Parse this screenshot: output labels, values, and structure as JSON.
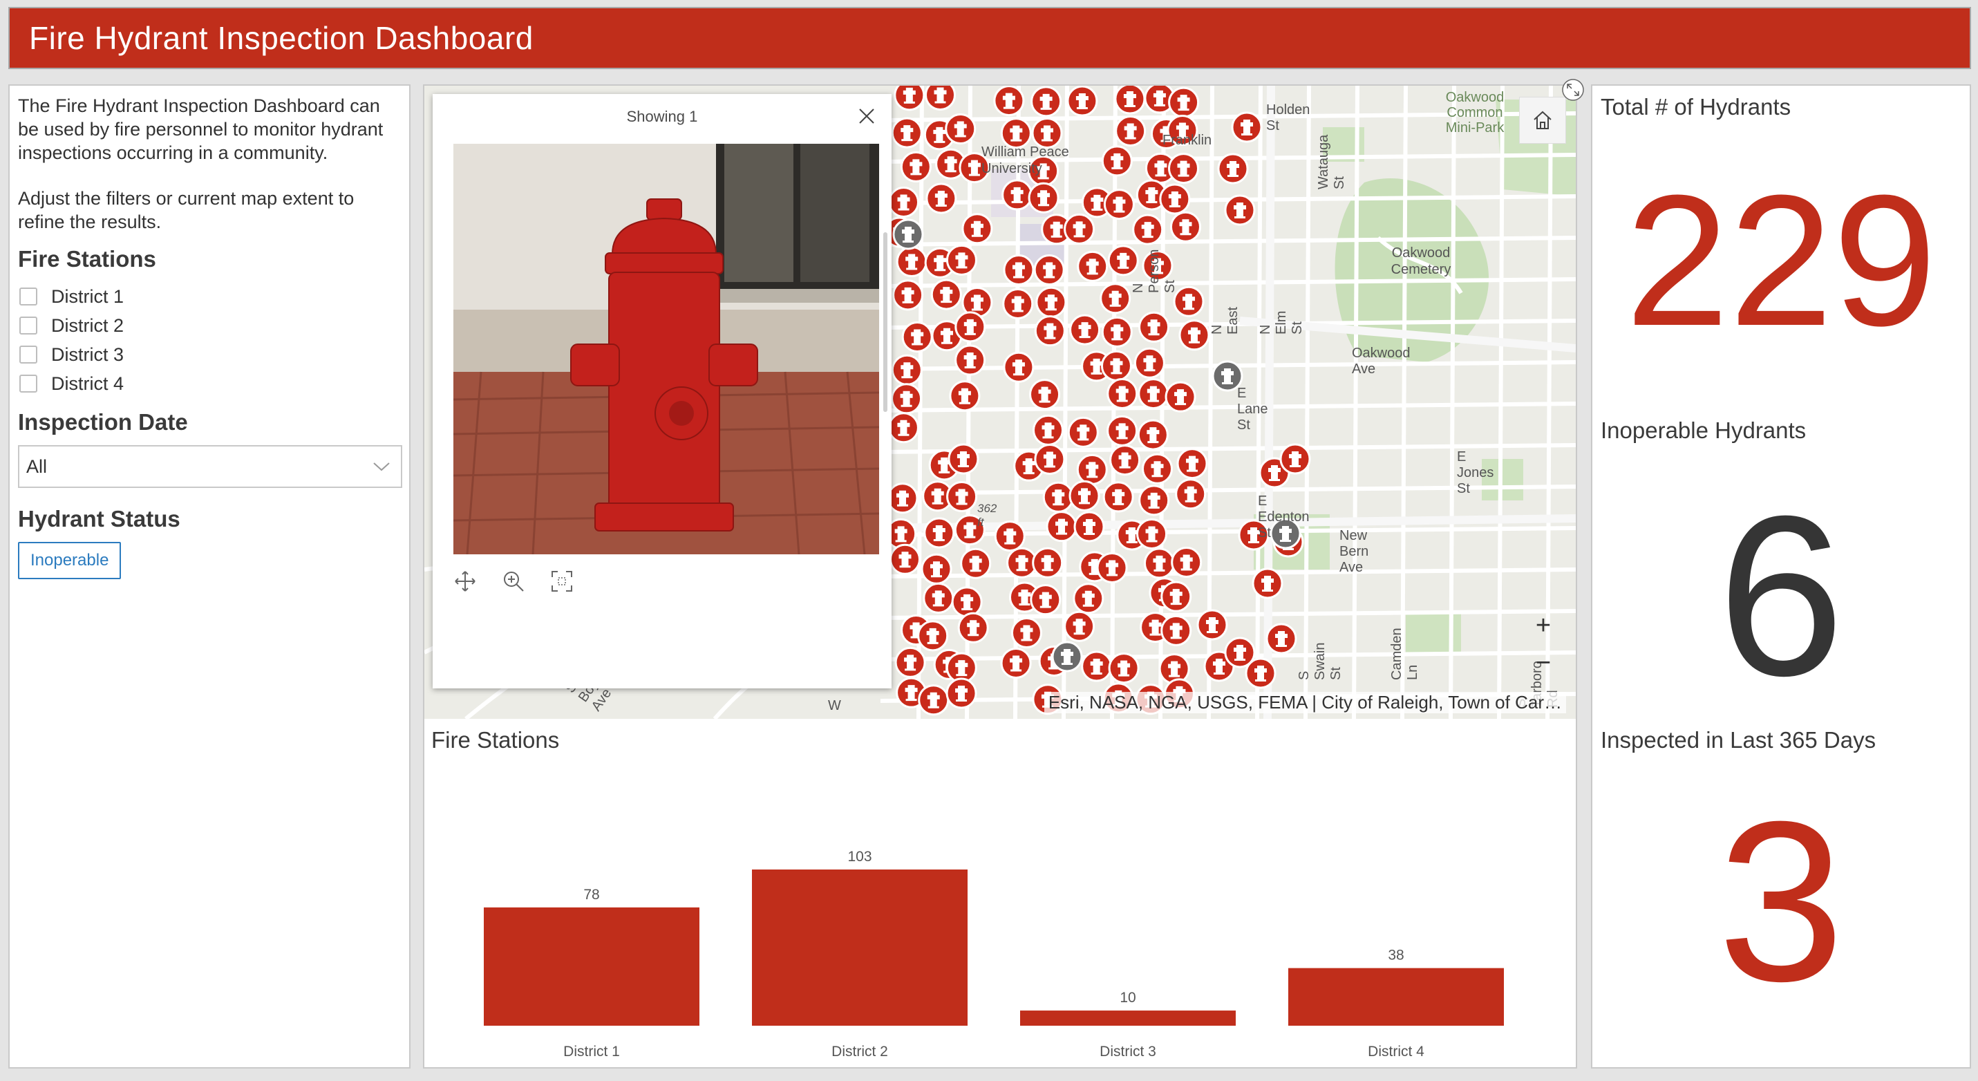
{
  "header": {
    "title": "Fire Hydrant Inspection Dashboard"
  },
  "sidebar": {
    "intro_p1": "The Fire Hydrant Inspection Dashboard can be used by fire personnel to monitor hydrant inspections occurring in a community.",
    "intro_p2": "Adjust the filters or current map extent to refine the results.",
    "fire_stations_title": "Fire Stations",
    "districts": [
      "District 1",
      "District 2",
      "District 3",
      "District 4"
    ],
    "inspection_date_title": "Inspection Date",
    "inspection_date_value": "All",
    "hydrant_status_title": "Hydrant Status",
    "hydrant_status_chip": "Inoperable"
  },
  "map": {
    "popup_title": "Showing 1",
    "attribution": "Esri, NASA, NGA, USGS, FEMA | City of Raleigh, Town of Car…",
    "labels": [
      "Holden St",
      "Oakwood Common Mini-Park",
      "William Peace University",
      "Franklin",
      "Watauga St",
      "Oakwood Cemetery",
      "Oakwood Ave",
      "N Elm St",
      "N East",
      "E Lane St",
      "E Jones St",
      "E Edenton St",
      "New Bern Ave",
      "362 ft",
      "N Person St",
      "S Swain St",
      "Camden Ln",
      "S Tarboro Rd",
      "S Boylan Ave",
      "W"
    ],
    "zoom_in": "+",
    "zoom_out": "−"
  },
  "chart_section": {
    "title": "Fire Stations"
  },
  "chart_data": {
    "type": "bar",
    "categories": [
      "District 1",
      "District 2",
      "District 3",
      "District 4"
    ],
    "values": [
      78,
      103,
      10,
      38
    ],
    "title": "Fire Stations",
    "color": "#c02e1b"
  },
  "metrics": {
    "total_title": "Total # of Hydrants",
    "total_value": "229",
    "total_color": "#c02e1b",
    "inoperable_title": "Inoperable Hydrants",
    "inoperable_value": "6",
    "inoperable_color": "#353535",
    "inspected_title": "Inspected in Last 365 Days",
    "inspected_value": "3",
    "inspected_color": "#c02e1b"
  },
  "icons": [
    "home-icon",
    "expand-icon",
    "close-icon",
    "pan-icon",
    "zoom-to-icon",
    "fullscreen-icon",
    "chevron-down-icon",
    "hydrant-marker-icon"
  ]
}
